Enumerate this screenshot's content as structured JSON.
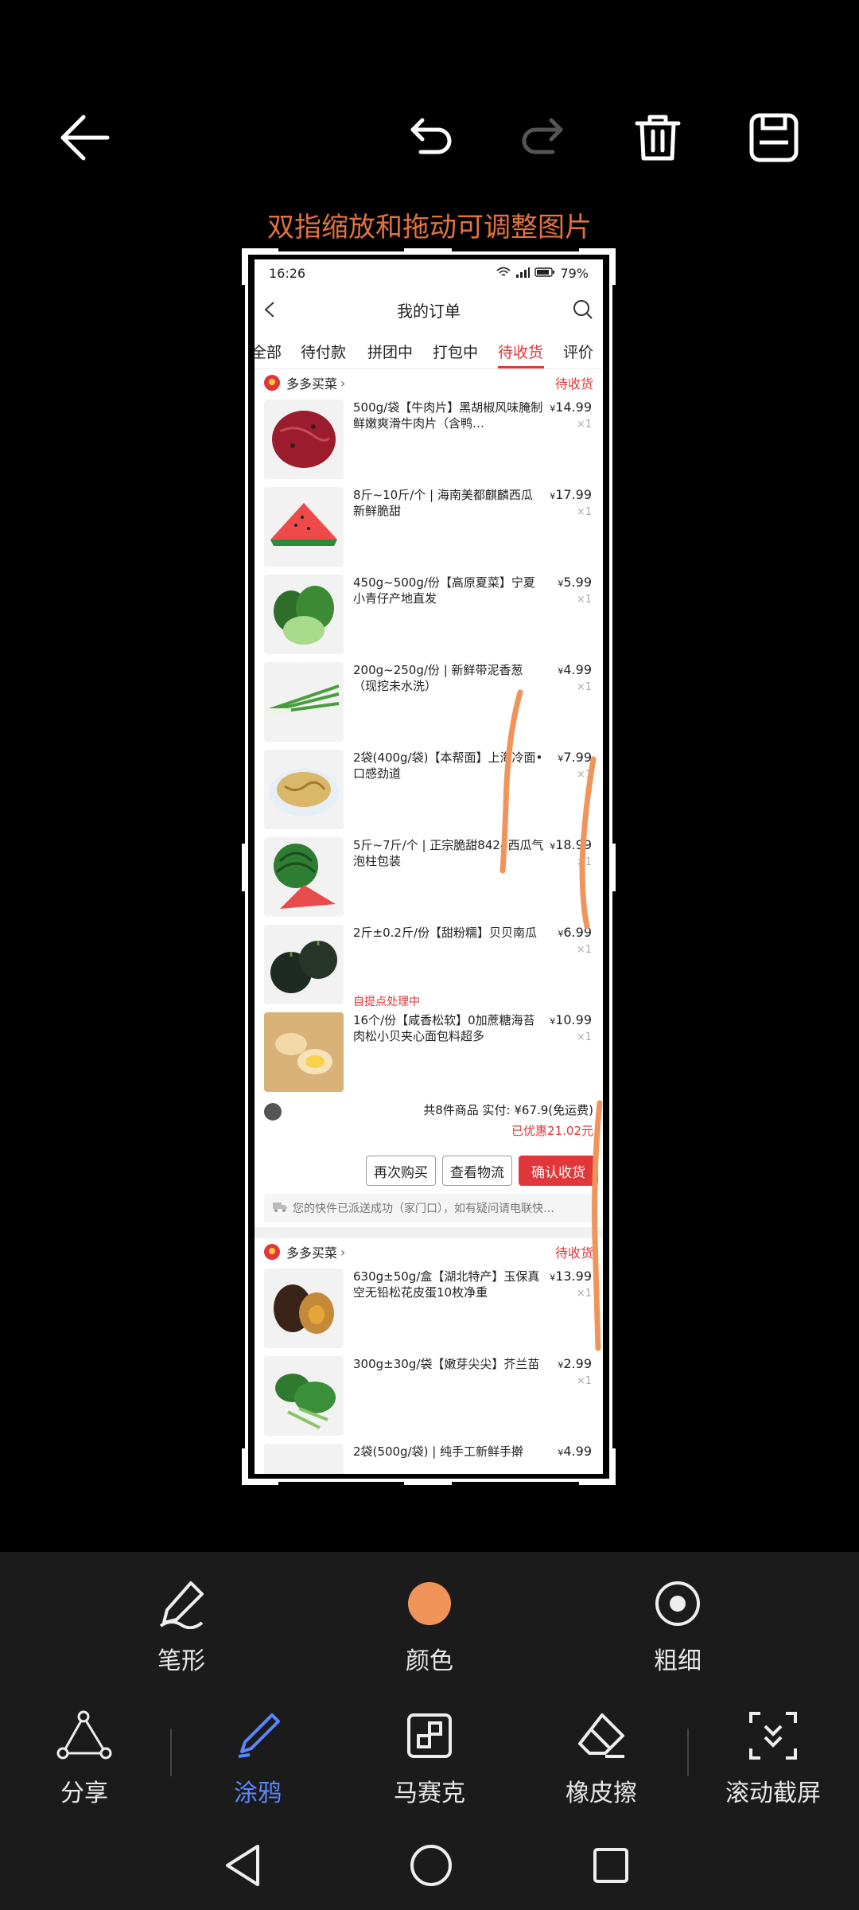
{
  "editor": {
    "hint": "双指缩放和拖动可调整图片",
    "top_icons": [
      "back-arrow-icon",
      "undo-icon",
      "redo-icon",
      "trash-icon",
      "save-icon"
    ],
    "pen_color": "#f0945a",
    "accent": "#e0733f"
  },
  "screenshot": {
    "status_bar": {
      "time": "16:26",
      "battery": "79%"
    },
    "title": "我的订单",
    "tabs": [
      "全部",
      "待付款",
      "拼团中",
      "打包中",
      "待收货",
      "评价"
    ],
    "active_tab": "待收货",
    "orders": [
      {
        "shop": "多多买菜",
        "status": "待收货",
        "items": [
          {
            "name": "500g/袋【牛肉片】黑胡椒风味腌制 鲜嫩爽滑牛肉片（含鸭…",
            "price": "14.99",
            "qty": "×1"
          },
          {
            "name": "8斤~10斤/个 | 海南美都麒麟西瓜新鲜脆甜",
            "price": "17.99",
            "qty": "×1"
          },
          {
            "name": "450g~500g/份【高原夏菜】宁夏小青仔产地直发",
            "price": "5.99",
            "qty": "×1"
          },
          {
            "name": "200g~250g/份 | 新鲜带泥香葱（现挖未水洗）",
            "price": "4.99",
            "qty": "×1"
          },
          {
            "name": "2袋(400g/袋)【本帮面】上海冷面•口感劲道",
            "price": "7.99",
            "qty": "×1"
          },
          {
            "name": "5斤~7斤/个 | 正宗脆甜8424西瓜气泡柱包装",
            "price": "18.99",
            "qty": "×1"
          },
          {
            "name": "2斤±0.2斤/份【甜粉糯】贝贝南瓜",
            "price": "6.99",
            "qty": "×1"
          },
          {
            "name": "16个/份【咸香松软】0加蔗糖海苔肉松小贝夹心面包料超多",
            "price": "10.99",
            "qty": "×1"
          }
        ],
        "pickup_note": "自提点处理中",
        "summary": "共8件商品 实付: ¥67.9(免运费)",
        "discount": "已优惠21.02元",
        "buttons": [
          "再次购买",
          "查看物流",
          "确认收货"
        ],
        "notice": "您的快件已派送成功（家门口），如有疑问请电联快…"
      },
      {
        "shop": "多多买菜",
        "status": "待收货",
        "items": [
          {
            "name": "630g±50g/盒【湖北特产】玉保真空无铅松花皮蛋10枚净重",
            "price": "13.99",
            "qty": "×1"
          },
          {
            "name": "300g±30g/袋【嫩芽尖尖】芥兰苗",
            "price": "2.99",
            "qty": "×1"
          },
          {
            "name": "2袋(500g/袋) | 纯手工新鲜手擀",
            "price": "4.99",
            "qty": ""
          }
        ]
      }
    ]
  },
  "tools_row1": [
    {
      "label": "笔形",
      "icon": "brush-stroke-icon"
    },
    {
      "label": "颜色",
      "icon": "color-dot-icon"
    },
    {
      "label": "粗细",
      "icon": "thickness-icon"
    }
  ],
  "tools_row2": [
    {
      "label": "分享",
      "icon": "share-icon"
    },
    {
      "label": "涂鸦",
      "icon": "pen-icon",
      "selected": true
    },
    {
      "label": "马赛克",
      "icon": "mosaic-icon"
    },
    {
      "label": "橡皮擦",
      "icon": "eraser-icon"
    },
    {
      "label": "滚动截屏",
      "icon": "scroll-screenshot-icon"
    }
  ],
  "system_nav": [
    "back-triangle-icon",
    "home-circle-icon",
    "recents-square-icon"
  ]
}
